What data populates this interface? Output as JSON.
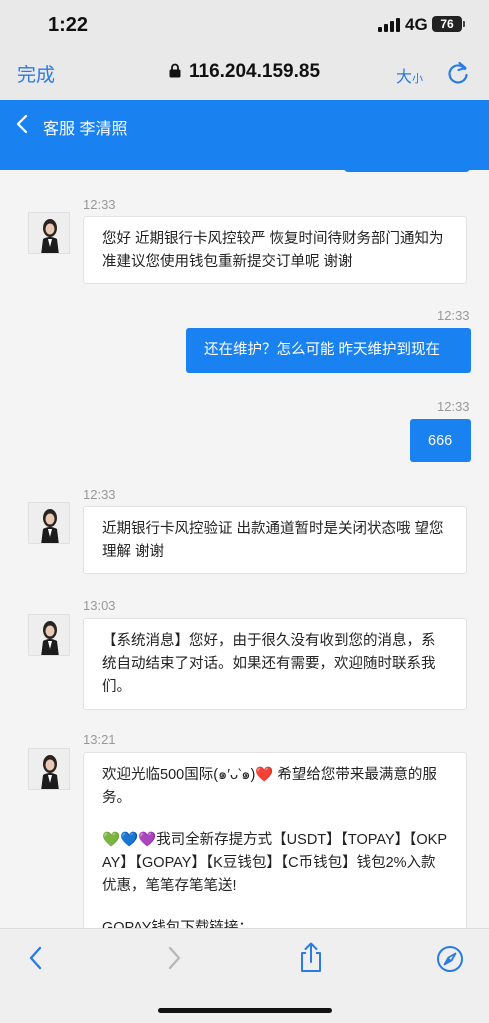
{
  "status_bar": {
    "time": "1:22",
    "network": "4G",
    "battery": "76"
  },
  "browser": {
    "done_label": "完成",
    "url": "116.204.159.85",
    "text_size_big": "大",
    "text_size_small": "小"
  },
  "chat_header": {
    "title": "客服 李清照"
  },
  "messages": [
    {
      "time": "12:33",
      "text": "您好 近期银行卡风控较严 恢复时间待财务部门通知为准建议您使用钱包重新提交订单呢 谢谢"
    },
    {
      "time": "12:33",
      "text": "还在维护？怎么可能 昨天维护到现在"
    },
    {
      "time": "12:33",
      "text": "666"
    },
    {
      "time": "12:33",
      "text": "近期银行卡风控验证 出款通道暂时是关闭状态哦 望您理解 谢谢"
    },
    {
      "time": "13:03",
      "text": "【系统消息】您好，由于很久没有收到您的消息，系统自动结束了对话。如果还有需要，欢迎随时联系我们。"
    },
    {
      "time": "13:21",
      "welcome_text": "欢迎光临500国际(๑′ᴗ‵๑)",
      "welcome_emoji": "❤️",
      "welcome_text2": " 希望给您带来最满意的服务。",
      "hearts": [
        "💚",
        "💙",
        "💜"
      ],
      "methods_text": "我司全新存提方式【USDT】【TOPAY】【OKPAY】【GOPAY】【K豆钱包】【C币钱包】钱包2%入款优惠，笔笔存笔笔送!",
      "link_text": "GOPAY钱包下载链接："
    }
  ],
  "icons": {
    "lock": "lock-icon",
    "reload": "reload-icon",
    "back": "chevron-left-icon",
    "forward": "chevron-right-icon",
    "share": "share-icon",
    "safari": "compass-icon"
  },
  "colors": {
    "accent": "#1a82f0",
    "browser_link": "#2a7be4",
    "heart_red": "#e0262f"
  }
}
